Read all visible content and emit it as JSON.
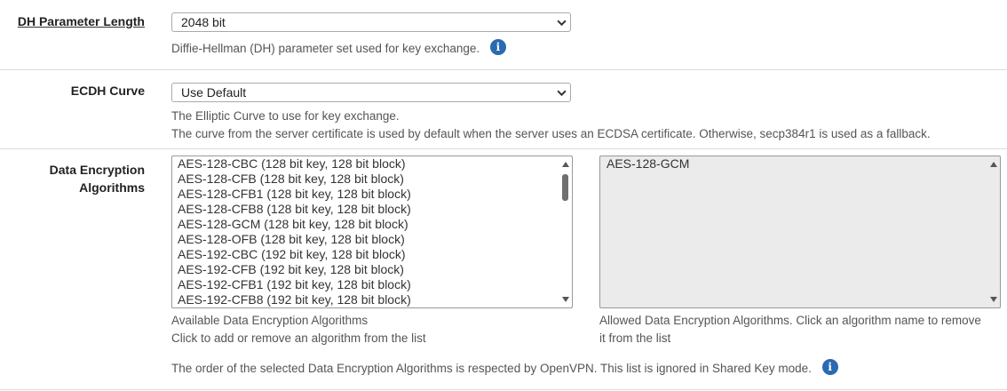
{
  "dh": {
    "label": "DH Parameter Length",
    "selected": "2048 bit",
    "help": "Diffie-Hellman (DH) parameter set used for key exchange."
  },
  "ecdh": {
    "label": "ECDH Curve",
    "selected": "Use Default",
    "help1": "The Elliptic Curve to use for key exchange.",
    "help2": "The curve from the server certificate is used by default when the server uses an ECDSA certificate. Otherwise, secp384r1 is used as a fallback."
  },
  "dea": {
    "label_line1": "Data Encryption",
    "label_line2": "Algorithms",
    "available": [
      "AES-128-CBC (128 bit key, 128 bit block)",
      "AES-128-CFB (128 bit key, 128 bit block)",
      "AES-128-CFB1 (128 bit key, 128 bit block)",
      "AES-128-CFB8 (128 bit key, 128 bit block)",
      "AES-128-GCM (128 bit key, 128 bit block)",
      "AES-128-OFB (128 bit key, 128 bit block)",
      "AES-192-CBC (192 bit key, 128 bit block)",
      "AES-192-CFB (192 bit key, 128 bit block)",
      "AES-192-CFB1 (192 bit key, 128 bit block)",
      "AES-192-CFB8 (192 bit key, 128 bit block)"
    ],
    "allowed": [
      "AES-128-GCM"
    ],
    "available_help1": "Available Data Encryption Algorithms",
    "available_help2": "Click to add or remove an algorithm from the list",
    "allowed_help1": "Allowed Data Encryption Algorithms. Click an algorithm name to remove",
    "allowed_help2": "it from the list",
    "order_note": "The order of the selected Data Encryption Algorithms is respected by OpenVPN. This list is ignored in Shared Key mode."
  },
  "icons": {
    "info": "i"
  },
  "colors": {
    "info": "#2a6ab0",
    "allowed_bg": "#ebebeb"
  }
}
